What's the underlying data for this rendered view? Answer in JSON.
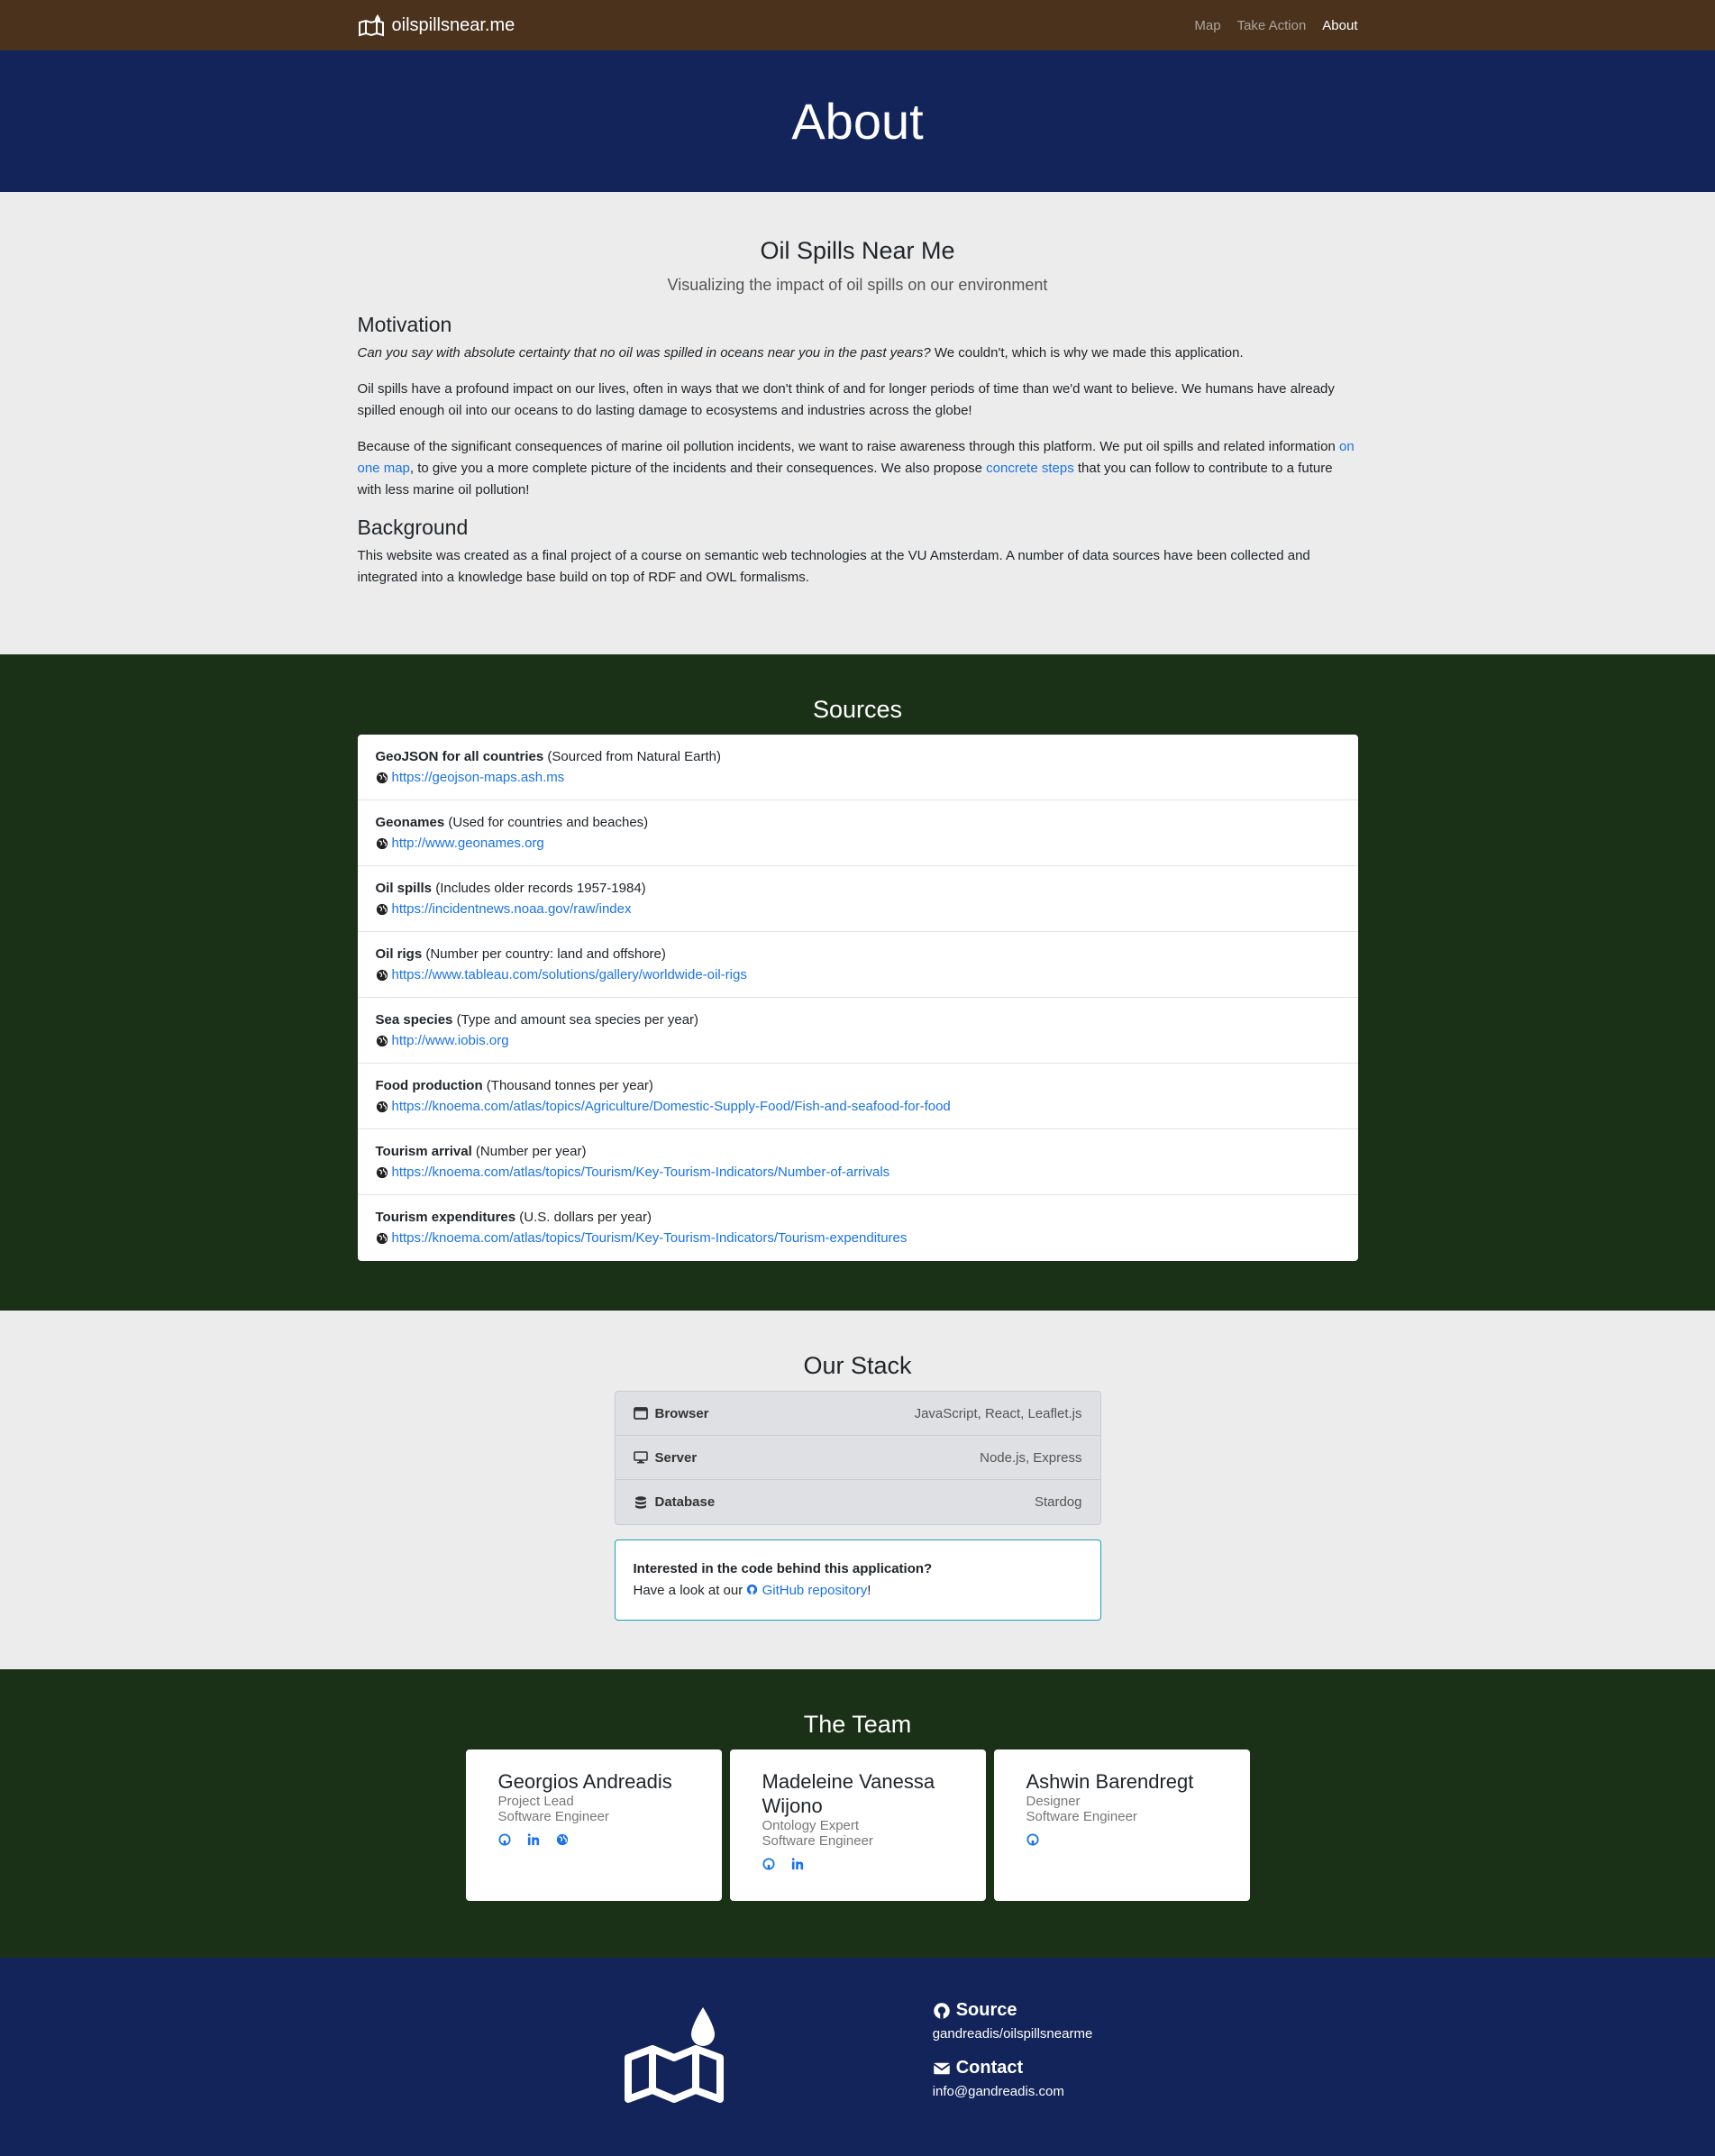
{
  "nav": {
    "brand": "oilspillsnear.me",
    "links": [
      {
        "label": "Map"
      },
      {
        "label": "Take Action"
      },
      {
        "label": "About"
      }
    ]
  },
  "hero": {
    "title": "About"
  },
  "about": {
    "title": "Oil Spills Near Me",
    "lead": "Visualizing the impact of oil spills on our environment",
    "motivation_heading": "Motivation",
    "p1_italic": "Can you say with absolute certainty that no oil was spilled in oceans near you in the past years?",
    "p1_rest": " We couldn't, which is why we made this application.",
    "p2": "Oil spills have a profound impact on our lives, often in ways that we don't think of and for longer periods of time than we'd want to believe. We humans have already spilled enough oil into our oceans to do lasting damage to ecosystems and industries across the globe!",
    "p3_a": "Because of the significant consequences of marine oil pollution incidents, we want to raise awareness through this platform. We put oil spills and related information ",
    "p3_link1": "on one map",
    "p3_b": ", to give you a more complete picture of the incidents and their consequences. We also propose ",
    "p3_link2": "concrete steps",
    "p3_c": " that you can follow to contribute to a future with less marine oil pollution!",
    "background_heading": "Background",
    "p4": "This website was created as a final project of a course on semantic web technologies at the VU Amsterdam. A number of data sources have been collected and integrated into a knowledge base build on top of RDF and OWL formalisms."
  },
  "sources": {
    "title": "Sources",
    "items": [
      {
        "name": "GeoJSON for all countries",
        "desc": " (Sourced from Natural Earth)",
        "url": "https://geojson-maps.ash.ms"
      },
      {
        "name": "Geonames",
        "desc": " (Used for countries and beaches)",
        "url": "http://www.geonames.org"
      },
      {
        "name": "Oil spills",
        "desc": " (Includes older records 1957-1984)",
        "url": "https://incidentnews.noaa.gov/raw/index"
      },
      {
        "name": "Oil rigs",
        "desc": " (Number per country: land and offshore)",
        "url": "https://www.tableau.com/solutions/gallery/worldwide-oil-rigs"
      },
      {
        "name": "Sea species",
        "desc": " (Type and amount sea species per year)",
        "url": "http://www.iobis.org"
      },
      {
        "name": "Food production",
        "desc": " (Thousand tonnes per year)",
        "url": "https://knoema.com/atlas/topics/Agriculture/Domestic-Supply-Food/Fish-and-seafood-for-food"
      },
      {
        "name": "Tourism arrival",
        "desc": " (Number per year)",
        "url": "https://knoema.com/atlas/topics/Tourism/Key-Tourism-Indicators/Number-of-arrivals"
      },
      {
        "name": "Tourism expenditures",
        "desc": " (U.S. dollars per year)",
        "url": "https://knoema.com/atlas/topics/Tourism/Key-Tourism-Indicators/Tourism-expenditures"
      }
    ]
  },
  "stack": {
    "title": "Our Stack",
    "rows": [
      {
        "key": "Browser",
        "value": "JavaScript, React, Leaflet.js"
      },
      {
        "key": "Server",
        "value": "Node.js, Express"
      },
      {
        "key": "Database",
        "value": "Stardog"
      }
    ],
    "info_title": "Interested in the code behind this application?",
    "info_pre": "Have a look at our ",
    "info_link": "GitHub repository",
    "info_post": "!"
  },
  "team": {
    "title": "The Team",
    "members": [
      {
        "name": "Georgios Andreadis",
        "role1": "Project Lead",
        "role2": "Software Engineer"
      },
      {
        "name": "Madeleine Vanessa Wijono",
        "role1": "Ontology Expert",
        "role2": "Software Engineer"
      },
      {
        "name": "Ashwin Barendregt",
        "role1": "Designer",
        "role2": "Software Engineer"
      }
    ]
  },
  "footer": {
    "source_heading": "Source",
    "source_value": "gandreadis/oilspillsnearme",
    "contact_heading": "Contact",
    "contact_value": "info@gandreadis.com"
  }
}
